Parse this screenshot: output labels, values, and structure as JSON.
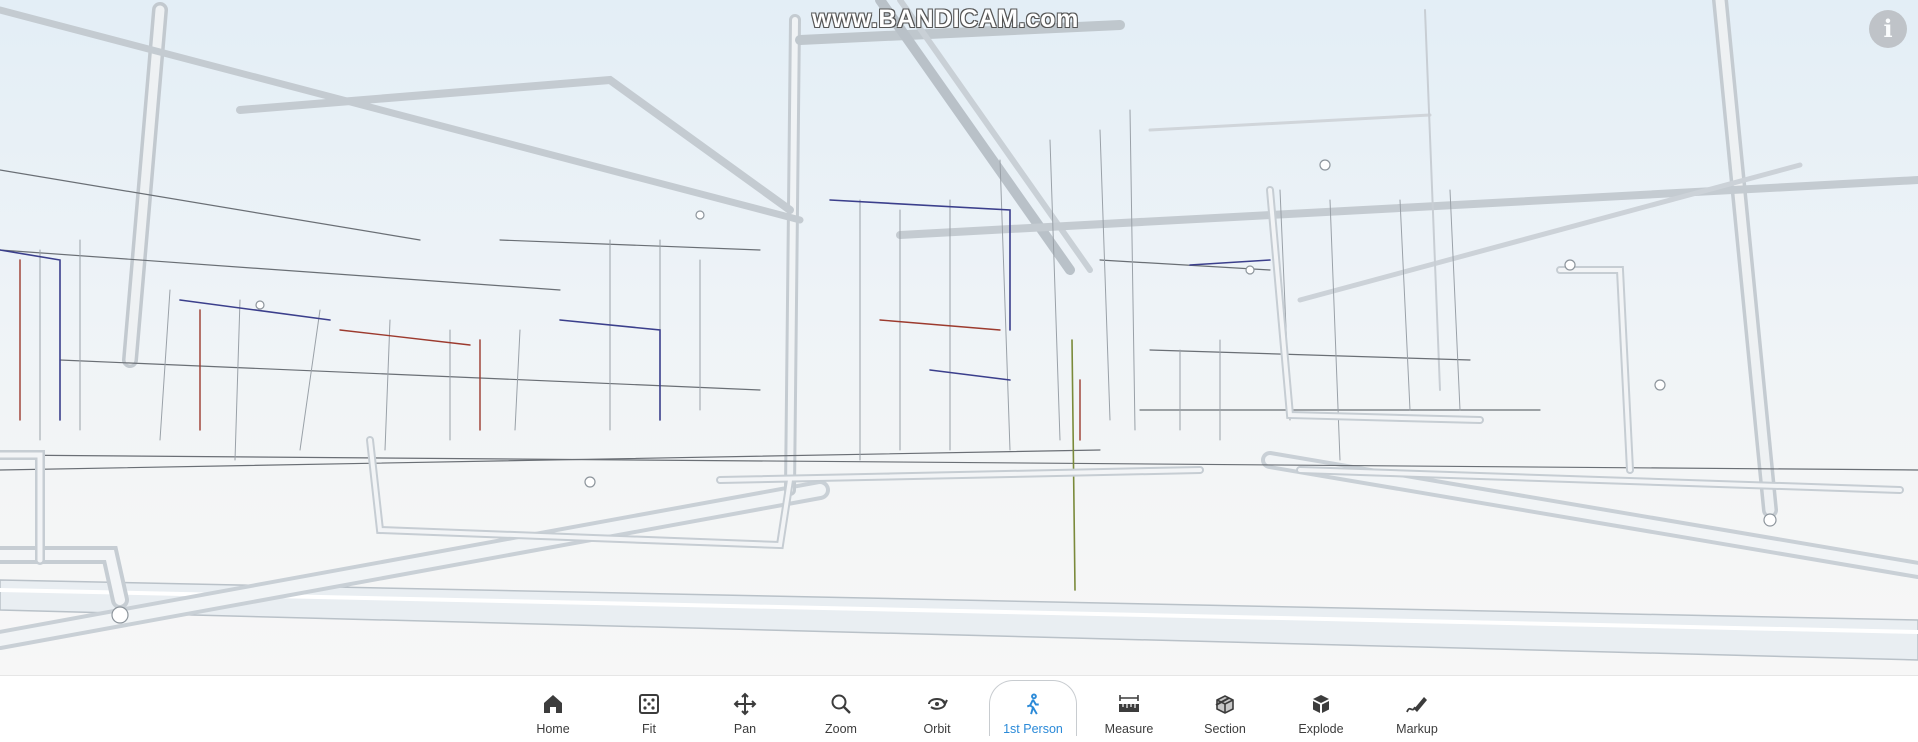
{
  "watermark": "www.BANDICAM.com",
  "info_button": {
    "label": "i"
  },
  "toolbar": {
    "items": [
      {
        "label": "Home",
        "icon": "home-icon"
      },
      {
        "label": "Fit",
        "icon": "fit-icon"
      },
      {
        "label": "Pan",
        "icon": "pan-icon"
      },
      {
        "label": "Zoom",
        "icon": "zoom-icon"
      },
      {
        "label": "Orbit",
        "icon": "orbit-icon"
      },
      {
        "label": "1st Person",
        "icon": "first-person-icon",
        "active": true
      },
      {
        "label": "Measure",
        "icon": "measure-icon"
      },
      {
        "label": "Section",
        "icon": "section-icon"
      },
      {
        "label": "Explode",
        "icon": "explode-icon"
      },
      {
        "label": "Markup",
        "icon": "markup-icon"
      }
    ]
  },
  "colors": {
    "active_accent": "#2b8ad8",
    "toolbar_bg": "#ffffff",
    "sky_top": "#e3eef6",
    "floor": "#f7f7f7"
  }
}
